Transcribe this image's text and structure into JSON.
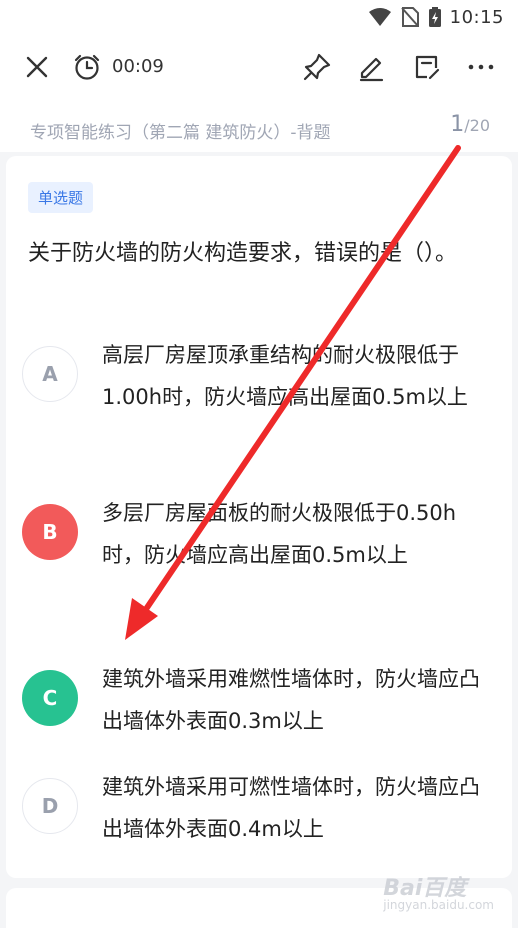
{
  "status": {
    "time": "10:15"
  },
  "toolbar": {
    "timer": "00:09",
    "icons": [
      "close-icon",
      "alarm-clock-icon",
      "pin-icon",
      "edit-icon",
      "note-icon",
      "more-icon"
    ]
  },
  "subheader": {
    "title": "专项智能练习（第二篇 建筑防火）-背题",
    "current": "1",
    "total": "/20"
  },
  "question": {
    "type": "单选题",
    "text": "关于防火墙的防火构造要求，错误的是（）。"
  },
  "options": [
    {
      "letter": "A",
      "text": "高层厂房屋顶承重结构的耐火极限低于1.00h时，防火墙应高出屋面0.5m以上",
      "state": "normal"
    },
    {
      "letter": "B",
      "text": "多层厂房屋面板的耐火极限低于0.50h时，防火墙应高出屋面0.5m以上",
      "state": "wrong"
    },
    {
      "letter": "C",
      "text": "建筑外墙采用难燃性墙体时，防火墙应凸出墙体外表面0.3m以上",
      "state": "correct"
    },
    {
      "letter": "D",
      "text": "建筑外墙采用可燃性墙体时，防火墙应凸出墙体外表面0.4m以上",
      "state": "normal"
    }
  ],
  "colors": {
    "wrong": "#f25a5a",
    "correct": "#27c291",
    "annotation_arrow": "#ee2a2a"
  },
  "watermark": {
    "text": "Bai百度",
    "sub": "jingyan.baidu.com"
  }
}
